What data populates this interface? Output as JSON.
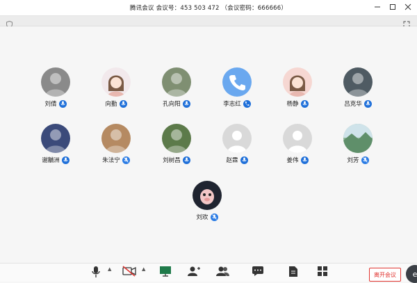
{
  "window": {
    "title": "腾讯会议  会议号：453 503 472  （会议密码：666666）"
  },
  "participants": [
    {
      "name": "刘倩",
      "avatar_icon": "photo-avatar-icon",
      "avatar_color": "#8a8a8a",
      "mic": "on"
    },
    {
      "name": "向勤",
      "avatar_icon": "cartoon-girl-avatar-icon",
      "avatar_color": "#f2e9ec",
      "mic": "on"
    },
    {
      "name": "孔向阳",
      "avatar_icon": "photo-avatar-icon",
      "avatar_color": "#7f8f72",
      "mic": "on"
    },
    {
      "name": "李志红",
      "avatar_icon": "phone-avatar-icon",
      "avatar_color": "#6aa8ef",
      "mic": "phone"
    },
    {
      "name": "杨静",
      "avatar_icon": "cartoon-girl-avatar-icon",
      "avatar_color": "#f6d7d2",
      "mic": "on"
    },
    {
      "name": "吕克华",
      "avatar_icon": "photo-avatar-icon",
      "avatar_color": "#4f5b63",
      "mic": "on"
    },
    {
      "name": "谢黼洲",
      "avatar_icon": "photo-avatar-icon",
      "avatar_color": "#3b4a7a",
      "mic": "on"
    },
    {
      "name": "朱法宁",
      "avatar_icon": "photo-avatar-icon",
      "avatar_color": "#b58a62",
      "mic": "muted"
    },
    {
      "name": "刘树昌",
      "avatar_icon": "photo-avatar-icon",
      "avatar_color": "#5c7a4a",
      "mic": "on"
    },
    {
      "name": "赵霖",
      "avatar_icon": "default-user-avatar-icon",
      "avatar_color": "#d9d9d9",
      "mic": "on"
    },
    {
      "name": "姜伟",
      "avatar_icon": "default-user-avatar-icon",
      "avatar_color": "#d9d9d9",
      "mic": "on"
    },
    {
      "name": "刘芳",
      "avatar_icon": "landscape-avatar-icon",
      "avatar_color": "#8fb69a",
      "mic": "muted"
    },
    {
      "name": "刘欢",
      "avatar_icon": "cartoon-pig-avatar-icon",
      "avatar_color": "#1f2430",
      "mic": "muted"
    }
  ],
  "toolbar": {
    "items": [
      {
        "id": "mic",
        "icon": "microphone-icon"
      },
      {
        "id": "video",
        "icon": "video-off-icon"
      },
      {
        "id": "share",
        "icon": "screen-share-icon"
      },
      {
        "id": "invite",
        "icon": "add-user-icon"
      },
      {
        "id": "members",
        "icon": "members-icon"
      },
      {
        "id": "chat",
        "icon": "chat-icon"
      },
      {
        "id": "doc",
        "icon": "document-icon"
      },
      {
        "id": "apps",
        "icon": "apps-icon"
      }
    ],
    "leave_label": "离开会议"
  },
  "colors": {
    "mic_blue": "#1e6fd9",
    "leave_red": "#e0322e"
  }
}
